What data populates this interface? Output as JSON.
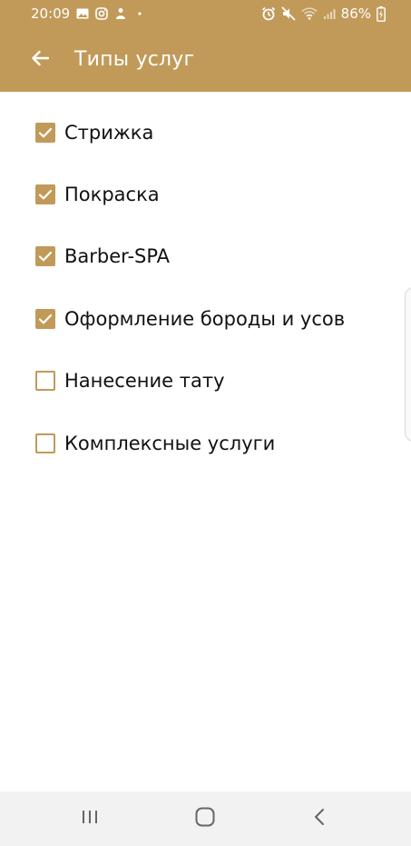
{
  "status_bar": {
    "time": "20:09",
    "battery": "86%",
    "left_icons": [
      "gallery-icon",
      "instagram-icon",
      "app-notification-icon",
      "dot-icon"
    ],
    "right_icons": [
      "alarm-icon",
      "mute-icon",
      "wifi-icon",
      "signal-icon"
    ]
  },
  "app_bar": {
    "title": "Типы услуг",
    "back_icon": "arrow-left-icon"
  },
  "services": [
    {
      "label": "Стрижка",
      "checked": true
    },
    {
      "label": "Покраска",
      "checked": true
    },
    {
      "label": "Barber-SPA",
      "checked": true
    },
    {
      "label": "Оформление бороды и усов",
      "checked": true
    },
    {
      "label": "Нанесение тату",
      "checked": false
    },
    {
      "label": "Комплексные услуги",
      "checked": false
    }
  ],
  "nav_bar": {
    "buttons": [
      "recent-apps-icon",
      "home-icon",
      "back-icon"
    ]
  },
  "colors": {
    "accent": "#c19a59",
    "text": "#111111",
    "background": "#ffffff",
    "nav_background": "#f2f2f2"
  }
}
